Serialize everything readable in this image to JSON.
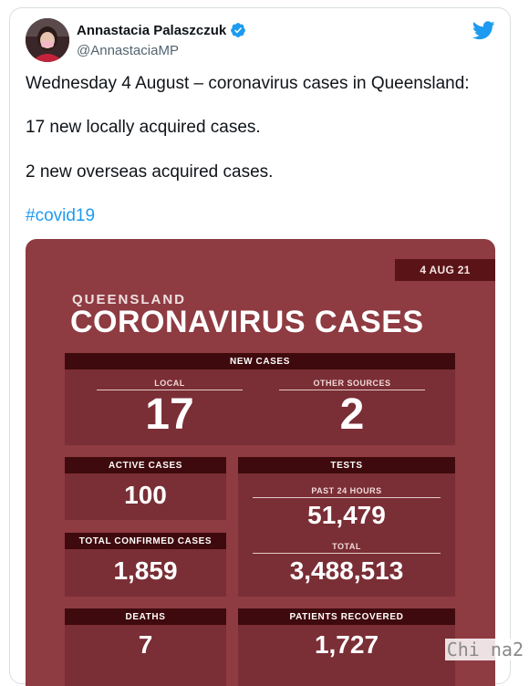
{
  "tweet": {
    "author_name": "Annastacia Palaszczuk",
    "handle": "@AnnastaciaMP",
    "lines": [
      "Wednesday 4 August – coronavirus cases in Queensland:",
      "17 new locally acquired cases.",
      "2 new overseas acquired cases."
    ],
    "hashtag": "#covid19"
  },
  "graphic": {
    "date": "4 AUG 21",
    "region": "QUEENSLAND",
    "headline": "CORONAVIRUS CASES",
    "new_cases": {
      "header": "NEW CASES",
      "local_label": "LOCAL",
      "local_value": "17",
      "other_label": "OTHER SOURCES",
      "other_value": "2"
    },
    "active_cases": {
      "header": "ACTIVE CASES",
      "value": "100"
    },
    "tests": {
      "header": "TESTS",
      "past_label": "PAST 24 HOURS",
      "past_value": "51,479",
      "total_label": "TOTAL",
      "total_value": "3,488,513"
    },
    "total_confirmed": {
      "header": "TOTAL CONFIRMED CASES",
      "value": "1,859"
    },
    "deaths": {
      "header": "DEATHS",
      "value": "7"
    },
    "recovered": {
      "header": "PATIENTS RECOVERED",
      "value": "1,727"
    }
  },
  "watermark": "Chi na2",
  "colors": {
    "twitter_blue": "#1d9bf0",
    "graphic_bg": "#8e3b42",
    "panel_bg": "#7a2e35",
    "header_bg": "#3f0a0d"
  },
  "icons": [
    "avatar",
    "verified-badge-icon",
    "twitter-bird-icon"
  ]
}
